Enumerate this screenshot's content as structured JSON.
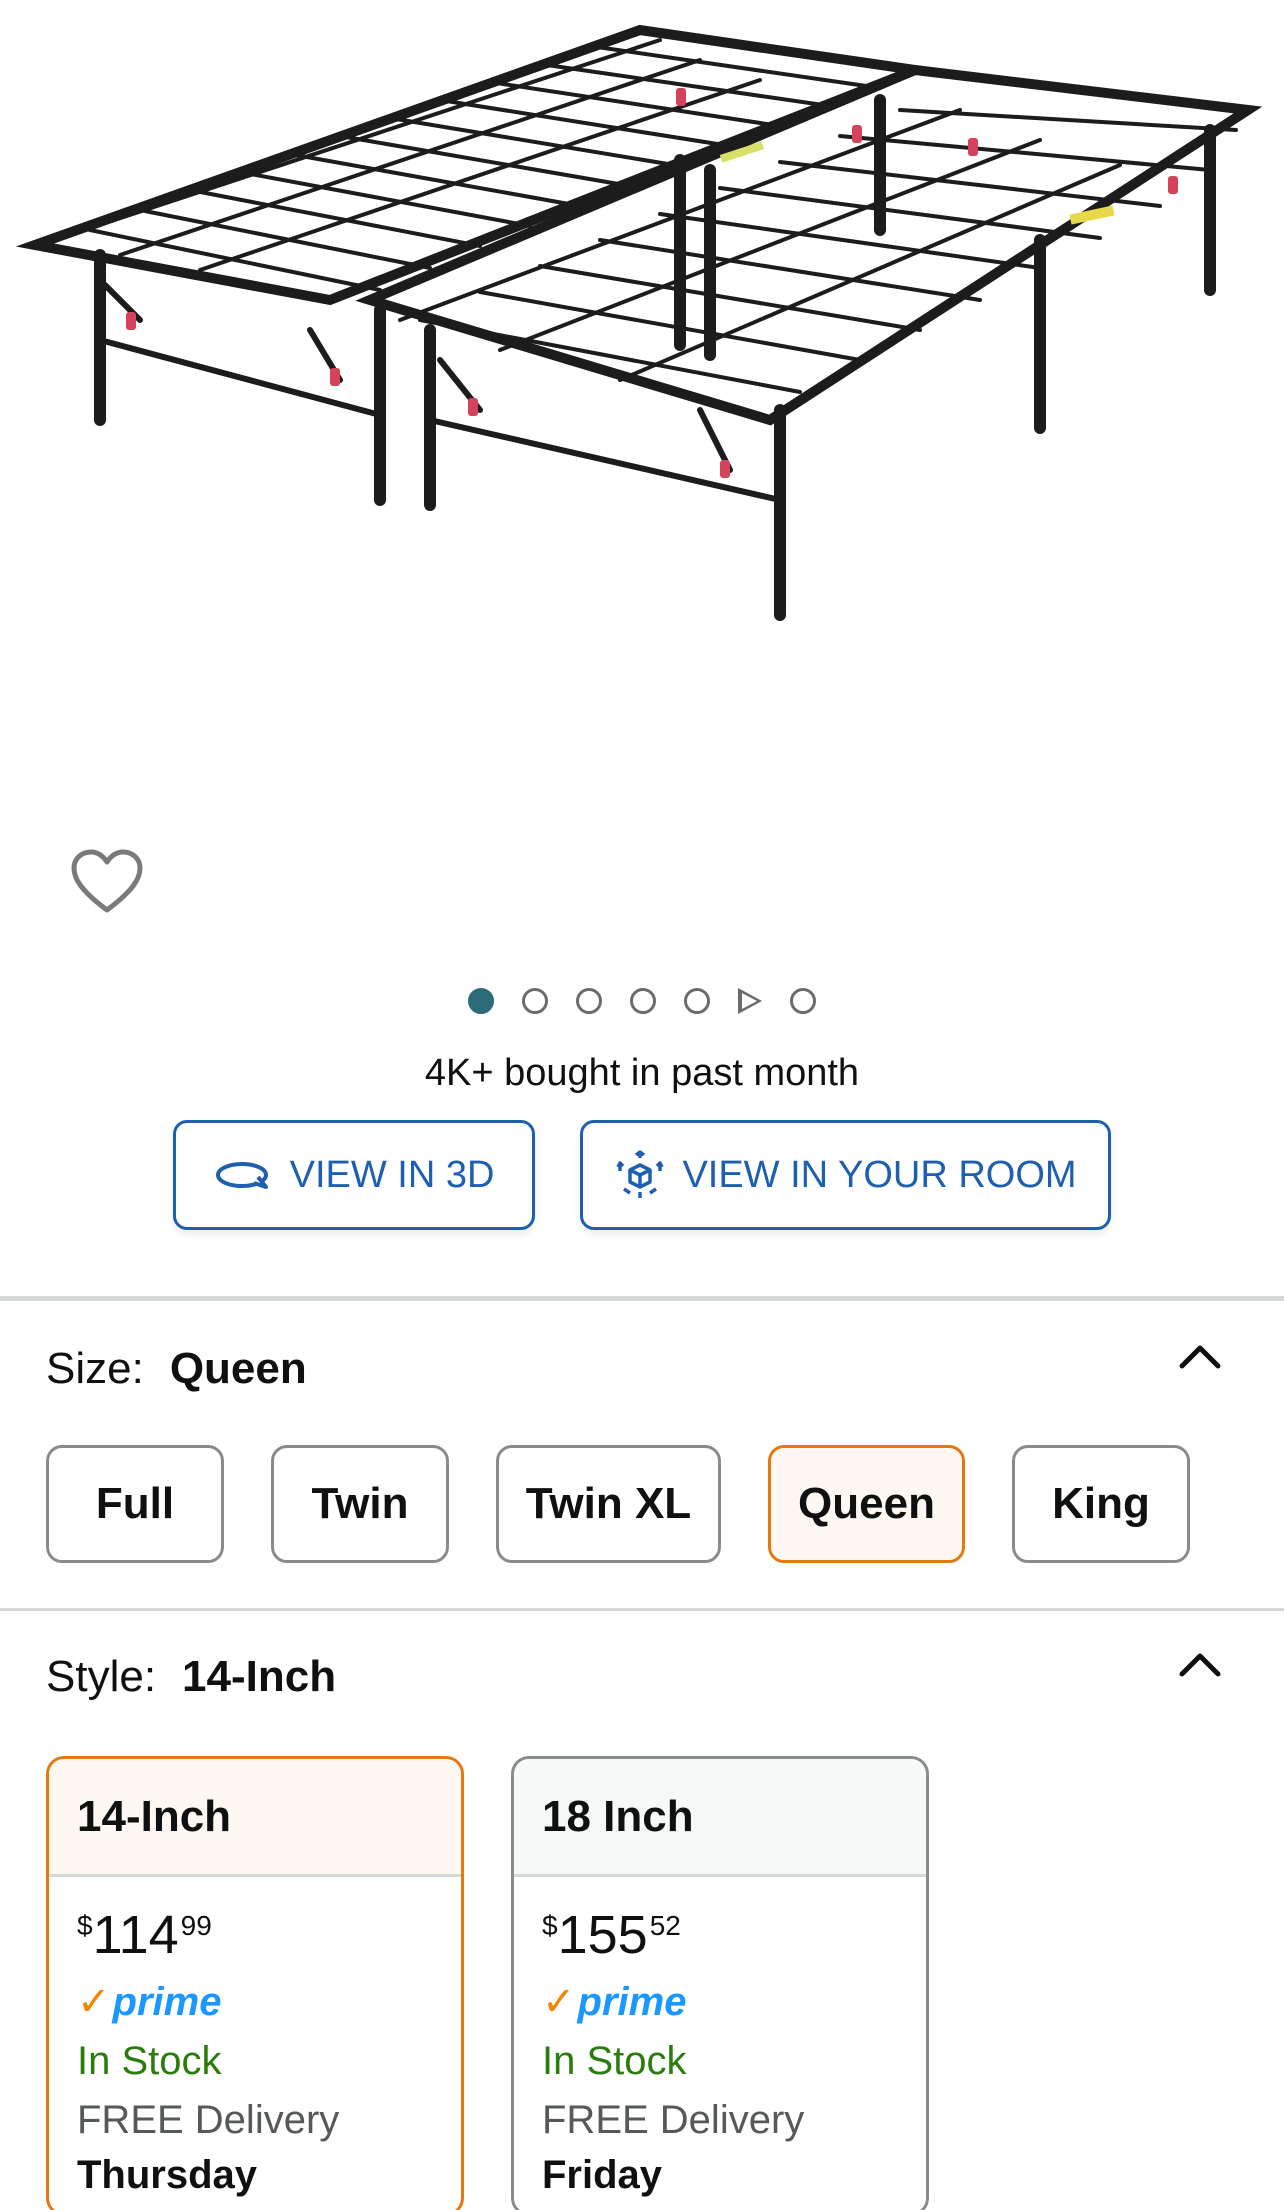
{
  "gallery": {
    "image_alt": "folding metal bed frame",
    "dots_total": 6,
    "active_index": 0
  },
  "social_proof": "4K+ bought in past month",
  "actions": {
    "view_3d": "VIEW IN 3D",
    "view_room": "VIEW IN YOUR ROOM"
  },
  "size": {
    "label": "Size:",
    "selected": "Queen",
    "options": [
      "Full",
      "Twin",
      "Twin XL",
      "Queen",
      "King"
    ]
  },
  "style": {
    "label": "Style:",
    "selected": "14-Inch",
    "cards": [
      {
        "name": "14-Inch",
        "currency": "$",
        "dollars": "114",
        "cents": "99",
        "prime": "prime",
        "stock": "In Stock",
        "delivery": "FREE Delivery",
        "day": "Thursday"
      },
      {
        "name": "18 Inch",
        "currency": "$",
        "dollars": "155",
        "cents": "52",
        "prime": "prime",
        "stock": "In Stock",
        "delivery": "FREE Delivery",
        "day": "Friday"
      }
    ]
  },
  "colors": {
    "link_blue": "#1f5fb0",
    "selected_orange": "#e47911",
    "stock_green": "#2a7d0c",
    "prime_blue": "#1a98ff"
  }
}
